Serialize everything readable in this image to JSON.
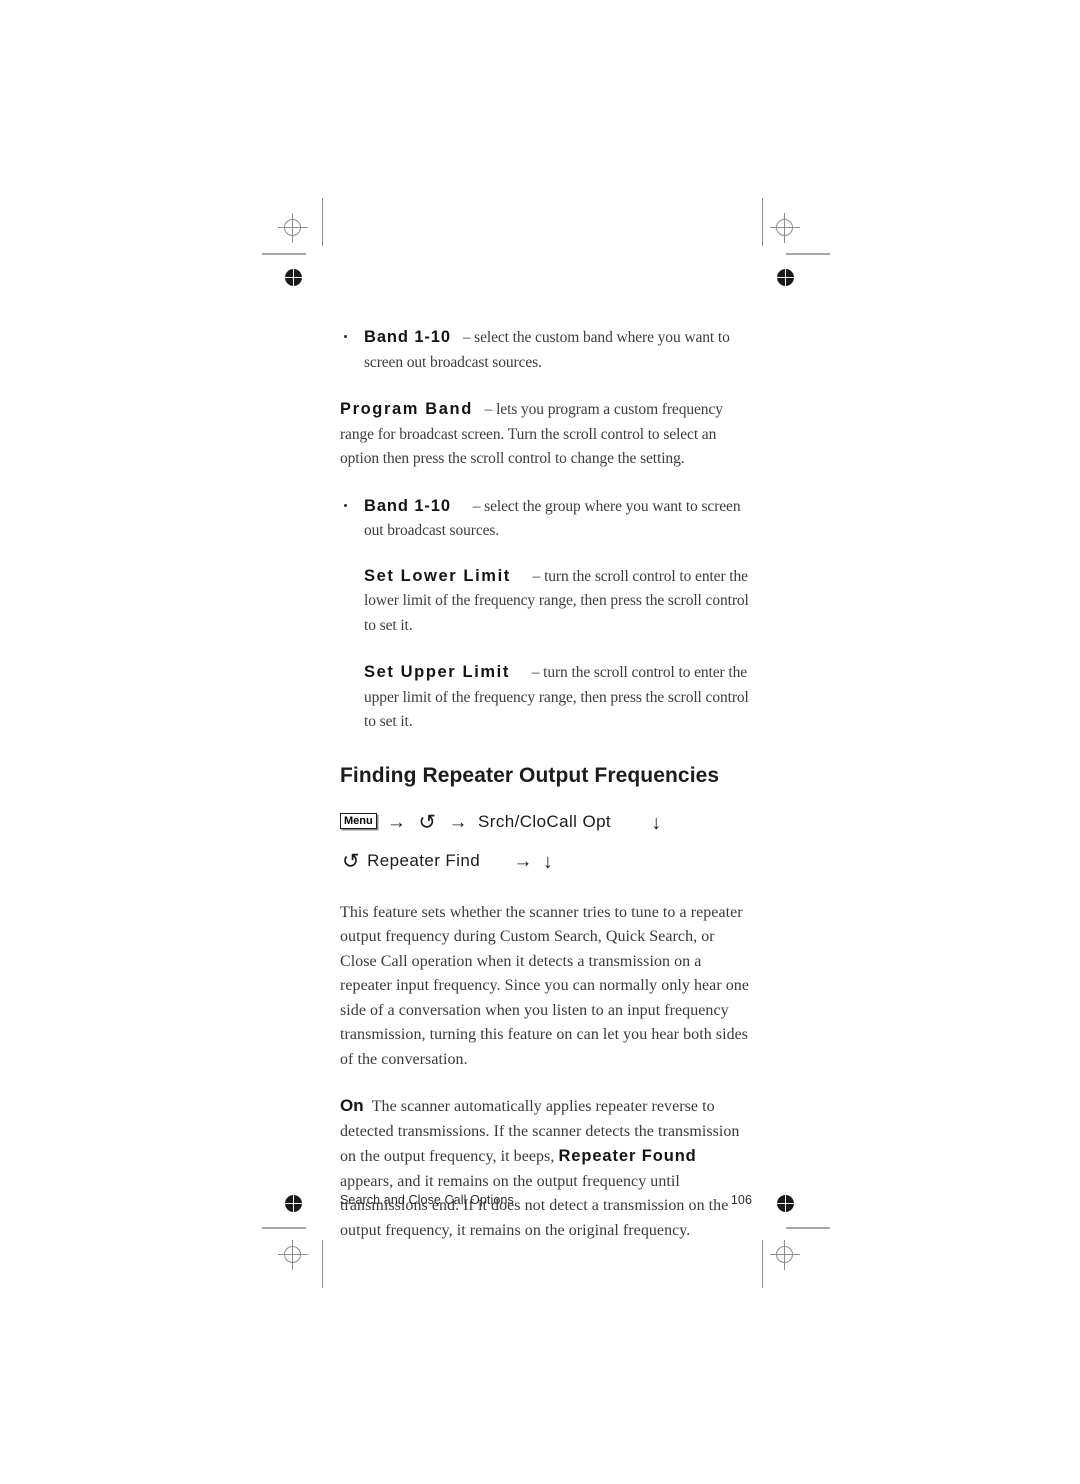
{
  "page": {
    "footer_title": "Search and Close Call Options",
    "page_number": "106"
  },
  "content": {
    "band_item_1": {
      "name": "Band 1-10",
      "description": "– select the custom band where you want to screen out broadcast sources."
    },
    "program_band": {
      "name": "Program Band",
      "description": "– lets you program a custom frequency range for broadcast screen. Turn the scroll control to select an option then press the scroll control to change the setting."
    },
    "band_item_2": {
      "name": "Band 1-10",
      "description": "– select the group where you want to screen out broadcast sources."
    },
    "set_lower_limit": {
      "name": "Set Lower Limit",
      "description": "– turn the scroll control to enter the lower limit of the frequency range, then press the scroll control to set it."
    },
    "set_upper_limit": {
      "name": "Set Upper Limit",
      "description": "– turn the scroll control to enter the upper limit of the frequency range, then press the scroll control to set it."
    },
    "section_heading": "Finding Repeater Output Frequencies",
    "keypath": {
      "menu_key": "Menu",
      "arrow_right": "→",
      "arrow_down": "↓",
      "scroll_symbol": "↺",
      "step_1_label": "Srch/CloCall Opt",
      "step_2_label": "Repeater Find"
    },
    "feature_paragraph": "This feature sets whether the scanner tries to tune to a repeater output frequency during Custom Search, Quick Search, or Close Call operation when it detects a transmission on a repeater input frequency. Since you can normally only hear one side of a conversation when you listen to an input frequency transmission, turning this feature on can let you hear both sides of the conversation.",
    "on_setting": {
      "label": "On",
      "text_part_1": "The scanner automatically applies repeater reverse to detected transmissions. If the scanner detects the transmission on the output frequency, it beeps,",
      "inline_bold": "Repeater Found",
      "text_part_2": "appears, and it remains on the output frequency until transmissions end. If it does not detect a transmission on the output frequency, it remains on the original frequency."
    }
  },
  "colors": {
    "text": "#333333",
    "heading": "#1c1c1c",
    "mark_gray": "#8c8c8c",
    "mark_black": "#1a1a1a"
  }
}
